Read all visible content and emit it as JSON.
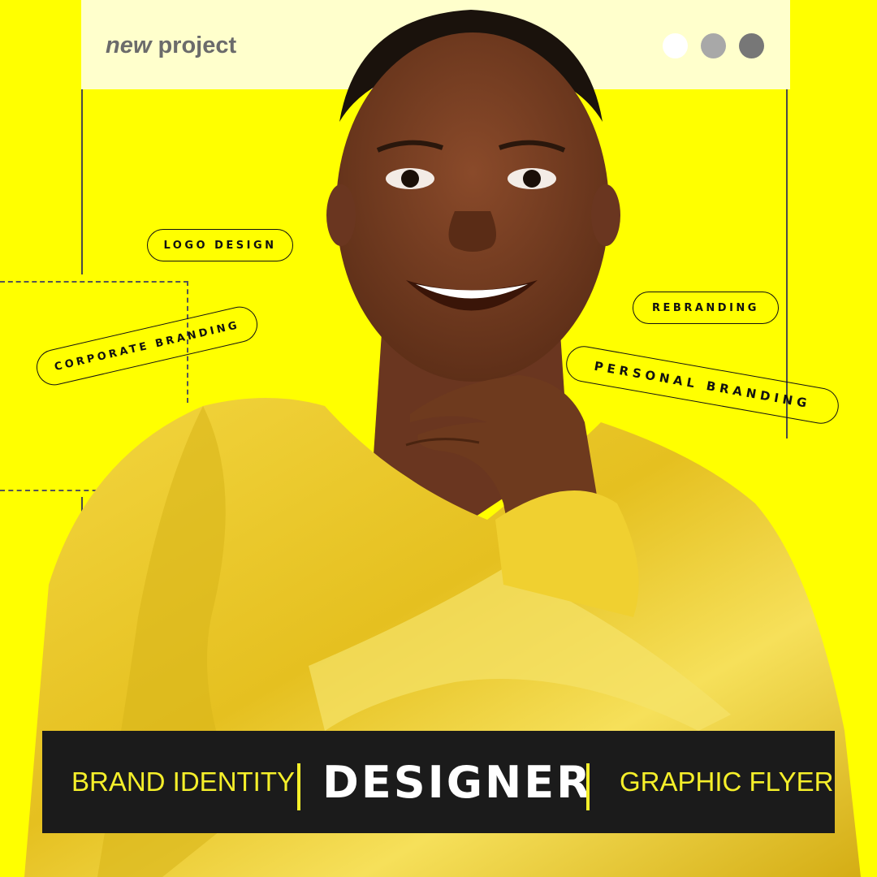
{
  "window": {
    "title_italic": "new",
    "title_rest": "project",
    "controls": [
      {
        "name": "dot-white",
        "color": "#ffffff"
      },
      {
        "name": "dot-light-gray",
        "color": "#a8a8a8"
      },
      {
        "name": "dot-dark-gray",
        "color": "#777777"
      }
    ]
  },
  "tags": {
    "logo_design": "LOGO DESIGN",
    "corporate_branding": "CORPORATE BRANDING",
    "rebranding": "REBRANDING",
    "personal_branding": "PERSONAL BRANDING"
  },
  "banner": {
    "left": "BRAND IDENTITY",
    "center": "DESIGNER",
    "right": "GRAPHIC FLYER"
  },
  "colors": {
    "background": "#ffff00",
    "titlebar": "#ffffcc",
    "banner": "#1b1b1b",
    "banner_accent": "#f5ef2a",
    "outfit": "#e8c51e"
  }
}
